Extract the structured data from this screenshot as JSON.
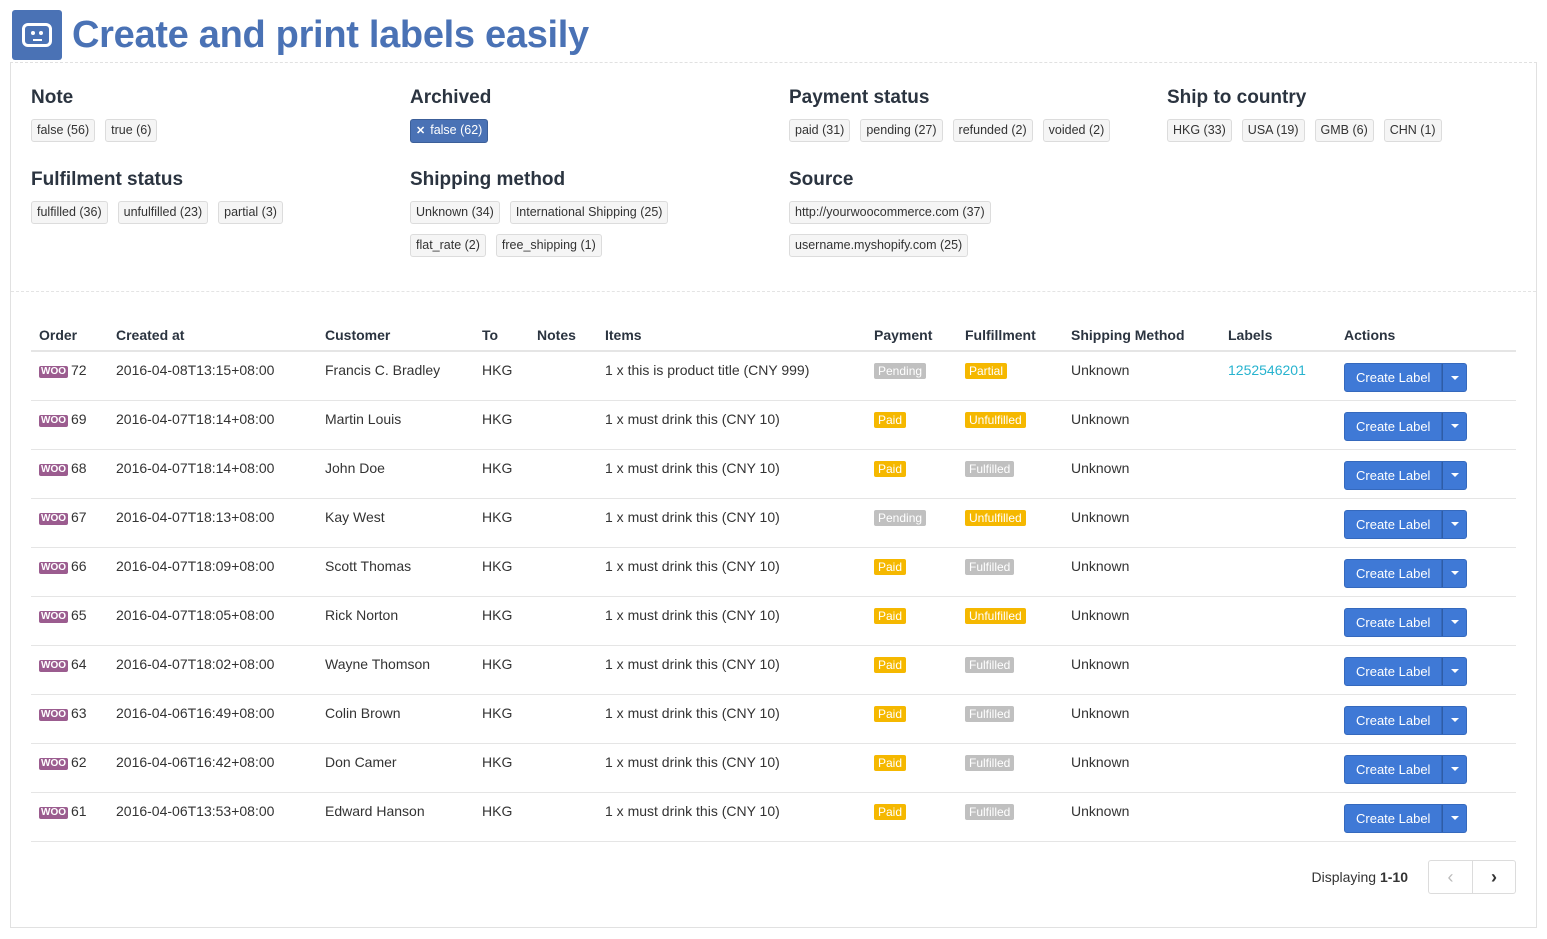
{
  "app": {
    "title": "Create and print labels easily",
    "logo_icon": "robot-face-icon"
  },
  "filters": {
    "note": {
      "title": "Note",
      "tags": [
        "false (56)",
        "true (6)"
      ]
    },
    "archived": {
      "title": "Archived",
      "tags": [
        "false (62)"
      ],
      "active_index": 0
    },
    "payment_status": {
      "title": "Payment status",
      "tags": [
        "paid (31)",
        "pending (27)",
        "refunded (2)",
        "voided (2)"
      ]
    },
    "ship_to_country": {
      "title": "Ship to country",
      "tags": [
        "HKG (33)",
        "USA (19)",
        "GMB (6)",
        "CHN (1)"
      ]
    },
    "fulfilment_status": {
      "title": "Fulfilment status",
      "tags": [
        "fulfilled (36)",
        "unfulfilled (23)",
        "partial (3)"
      ]
    },
    "shipping_method": {
      "title": "Shipping method",
      "tags": [
        "Unknown (34)",
        "International Shipping (25)",
        "flat_rate (2)",
        "free_shipping (1)"
      ]
    },
    "source": {
      "title": "Source",
      "tags": [
        "http://yourwoocommerce.com (37)",
        "username.myshopify.com (25)"
      ]
    }
  },
  "table": {
    "columns": [
      "Order",
      "Created at",
      "Customer",
      "To",
      "Notes",
      "Items",
      "Payment",
      "Fulfillment",
      "Shipping Method",
      "Labels",
      "Actions"
    ],
    "source_badge": "WOO",
    "action_label": "Create Label",
    "rows": [
      {
        "order": "72",
        "created_at": "2016-04-08T13:15+08:00",
        "customer": "Francis C. Bradley",
        "to": "HKG",
        "notes": "",
        "items": "1 x this is product title (CNY 999)",
        "payment": "Pending",
        "fulfillment": "Partial",
        "shipping": "Unknown",
        "label": "1252546201"
      },
      {
        "order": "69",
        "created_at": "2016-04-07T18:14+08:00",
        "customer": "Martin Louis",
        "to": "HKG",
        "notes": "",
        "items": "1 x must drink this (CNY 10)",
        "payment": "Paid",
        "fulfillment": "Unfulfilled",
        "shipping": "Unknown",
        "label": ""
      },
      {
        "order": "68",
        "created_at": "2016-04-07T18:14+08:00",
        "customer": "John Doe",
        "to": "HKG",
        "notes": "",
        "items": "1 x must drink this (CNY 10)",
        "payment": "Paid",
        "fulfillment": "Fulfilled",
        "shipping": "Unknown",
        "label": ""
      },
      {
        "order": "67",
        "created_at": "2016-04-07T18:13+08:00",
        "customer": "Kay West",
        "to": "HKG",
        "notes": "",
        "items": "1 x must drink this (CNY 10)",
        "payment": "Pending",
        "fulfillment": "Unfulfilled",
        "shipping": "Unknown",
        "label": ""
      },
      {
        "order": "66",
        "created_at": "2016-04-07T18:09+08:00",
        "customer": "Scott Thomas",
        "to": "HKG",
        "notes": "",
        "items": "1 x must drink this (CNY 10)",
        "payment": "Paid",
        "fulfillment": "Fulfilled",
        "shipping": "Unknown",
        "label": ""
      },
      {
        "order": "65",
        "created_at": "2016-04-07T18:05+08:00",
        "customer": "Rick Norton",
        "to": "HKG",
        "notes": "",
        "items": "1 x must drink this (CNY 10)",
        "payment": "Paid",
        "fulfillment": "Unfulfilled",
        "shipping": "Unknown",
        "label": ""
      },
      {
        "order": "64",
        "created_at": "2016-04-07T18:02+08:00",
        "customer": "Wayne Thomson",
        "to": "HKG",
        "notes": "",
        "items": "1 x must drink this (CNY 10)",
        "payment": "Paid",
        "fulfillment": "Fulfilled",
        "shipping": "Unknown",
        "label": ""
      },
      {
        "order": "63",
        "created_at": "2016-04-06T16:49+08:00",
        "customer": "Colin Brown",
        "to": "HKG",
        "notes": "",
        "items": "1 x must drink this (CNY 10)",
        "payment": "Paid",
        "fulfillment": "Fulfilled",
        "shipping": "Unknown",
        "label": ""
      },
      {
        "order": "62",
        "created_at": "2016-04-06T16:42+08:00",
        "customer": "Don Camer",
        "to": "HKG",
        "notes": "",
        "items": "1 x must drink this (CNY 10)",
        "payment": "Paid",
        "fulfillment": "Fulfilled",
        "shipping": "Unknown",
        "label": ""
      },
      {
        "order": "61",
        "created_at": "2016-04-06T13:53+08:00",
        "customer": "Edward Hanson",
        "to": "HKG",
        "notes": "",
        "items": "1 x must drink this (CNY 10)",
        "payment": "Paid",
        "fulfillment": "Fulfilled",
        "shipping": "Unknown",
        "label": ""
      }
    ]
  },
  "pagination": {
    "prefix": "Displaying",
    "range": "1-10",
    "prev_icon": "chevron-left-icon",
    "next_icon": "chevron-right-icon"
  },
  "colors": {
    "brand": "#4a72b5",
    "button": "#3f79d6",
    "paid": "#f5b800",
    "pending": "#c0c0c0",
    "link": "#27b3cf",
    "woo": "#9b5c8f"
  }
}
